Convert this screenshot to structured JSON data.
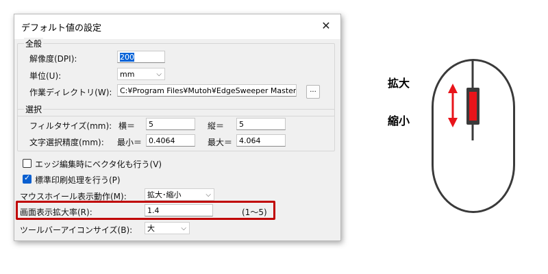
{
  "dialog": {
    "title": "デフォルト値の設定",
    "close_glyph": "✕",
    "general": {
      "legend": "全般",
      "dpi_label": "解像度(DPI):",
      "dpi_value": "200",
      "unit_label": "単位(U):",
      "unit_value": "mm",
      "workdir_label": "作業ディレクトリ(W):",
      "workdir_value": "C:¥Program Files¥Mutoh¥EdgeSweeper Master ¥",
      "browse_label": "..."
    },
    "selection": {
      "legend": "選択",
      "filter_label": "フィルタサイズ(mm):",
      "width_label": "横＝",
      "width_value": "5",
      "height_label": "縦＝",
      "height_value": "5",
      "precision_label": "文字選択精度(mm):",
      "min_label": "最小＝",
      "min_value": "0.4064",
      "max_label": "最大＝",
      "max_value": "4.064"
    },
    "vector_edit": {
      "label": "エッジ編集時にベクタ化も行う(V)",
      "checked": false
    },
    "standard_print": {
      "label": "標準印刷処理を行う(P)",
      "checked": true
    },
    "wheel": {
      "label": "マウスホイール表示動作(M):",
      "value": "拡大･縮小"
    },
    "zoom": {
      "label": "画面表示拡大率(R):",
      "value": "1.4",
      "range": "(1〜5)"
    },
    "toolbar_icon": {
      "label": "ツールバーアイコンサイズ(B):",
      "value": "大"
    }
  },
  "mouse_figure": {
    "zoom_in_label": "拡大",
    "zoom_out_label": "縮小",
    "accent_color": "#e8141a"
  },
  "colors": {
    "highlight_box": "#c00000",
    "selection": "#0a64d8"
  }
}
